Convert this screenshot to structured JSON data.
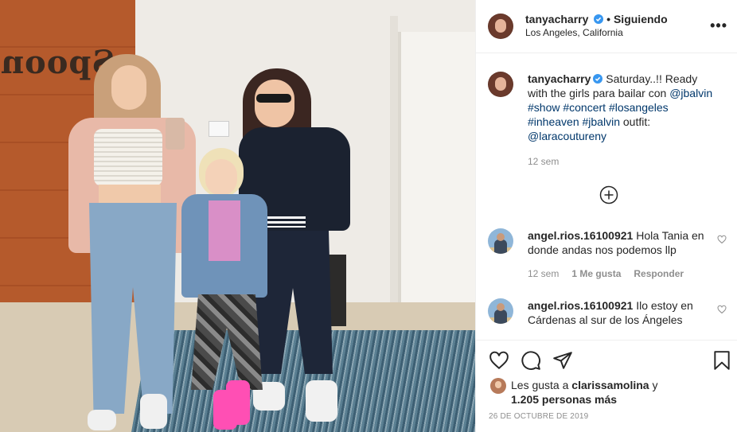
{
  "post": {
    "username": "tanyacharry",
    "follow_sep": "•",
    "follow_status": "Siguiendo",
    "location": "Los Angeles, California",
    "more_label": "•••"
  },
  "caption": {
    "username": "tanyacharry",
    "text_1": " Saturday..!! Ready with the girls para bailar con ",
    "mention_1": "@jbalvin",
    "tags_1": "#show #concert #losangeles #inheaven #jbalvin",
    "text_2": " outfit: ",
    "mention_2": "@laracouturenу",
    "time": "12 sem"
  },
  "comments": [
    {
      "username": "angel.rios.16100921",
      "text": " Hola Tania en donde andas nos podemos llp",
      "time": "12 sem",
      "likes": "1 Me gusta",
      "reply": "Responder"
    },
    {
      "username": "angel.rios.16100921",
      "text": " Ilo estoy en Cárdenas al sur de los Ángeles"
    }
  ],
  "likes": {
    "prefix": "Les gusta a ",
    "user": "clarissamolina",
    "suffix": " y",
    "others": "1.205 personas más"
  },
  "date": "26 de octubre de 2019",
  "photo": {
    "sign_text": "Spoon"
  },
  "icons": [
    "heart-icon",
    "comment-icon",
    "share-icon",
    "bookmark-icon",
    "add-circle-icon",
    "verified-icon",
    "more-icon"
  ],
  "colors": {
    "link": "#00376b",
    "verified": "#3897f0",
    "muted": "#8e8e8e"
  }
}
